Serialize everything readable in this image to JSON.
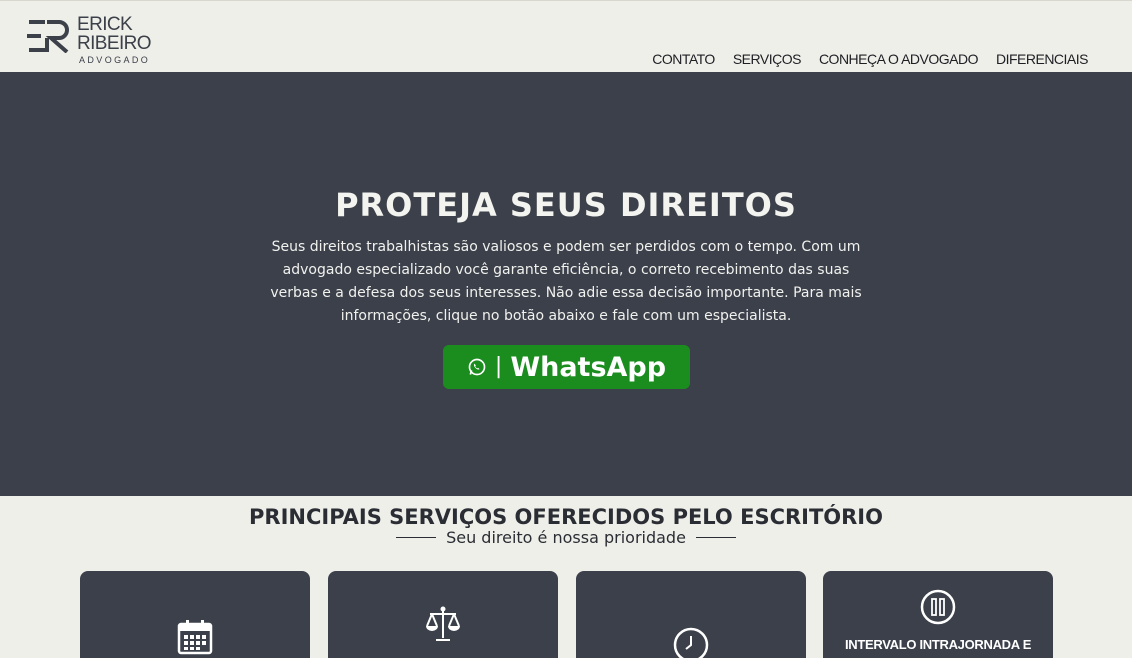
{
  "logo": {
    "line1": "ERICK",
    "line2": "RIBEIRO",
    "subtitle": "ADVOGADO"
  },
  "nav": {
    "items": [
      {
        "label": "CONTATO"
      },
      {
        "label": "SERVIÇOS"
      },
      {
        "label": "CONHEÇA O ADVOGADO"
      },
      {
        "label": "DIFERENCIAIS"
      }
    ]
  },
  "hero": {
    "title": "PROTEJA SEUS DIREITOS",
    "text": "Seus direitos trabalhistas são valiosos e podem ser perdidos com o tempo. Com um advogado especializado você garante eficiência, o correto recebimento das suas verbas e a defesa dos seus interesses. Não adie essa decisão importante. Para mais informações, clique no botão abaixo e fale com um especialista.",
    "button": {
      "separator": "|",
      "label": "WhatsApp",
      "icon": "whatsapp-icon"
    }
  },
  "services": {
    "title": "PRINCIPAIS SERVIÇOS OFERECIDOS PELO ESCRITÓRIO",
    "subtitle": "Seu direito é nossa prioridade",
    "cards": [
      {
        "icon": "calendar-icon",
        "title": ""
      },
      {
        "icon": "scales-icon",
        "title": ""
      },
      {
        "icon": "clock-icon",
        "title": ""
      },
      {
        "icon": "pause-icon",
        "title": "INTERVALO INTRAJORNADA E"
      }
    ]
  },
  "colors": {
    "background": "#efefea",
    "dark": "#3b404a",
    "whatsapp": "#1b8d1f",
    "text": "#2a2d33"
  }
}
